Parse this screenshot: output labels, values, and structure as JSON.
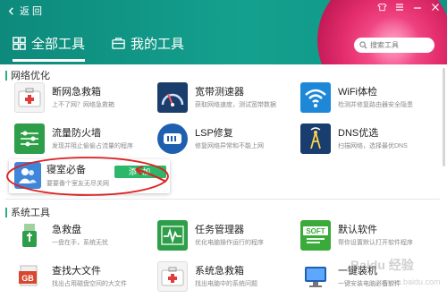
{
  "header": {
    "back_label": "返 回",
    "tabs": [
      {
        "label": "全部工具",
        "active": true
      },
      {
        "label": "我的工具",
        "active": false
      }
    ],
    "search_placeholder": "搜索工具",
    "window_controls": [
      "shirt-icon",
      "menu-icon",
      "minimize-icon",
      "close-icon"
    ]
  },
  "sections": [
    {
      "title": "网络优化",
      "items": [
        {
          "name": "断网急救箱",
          "desc": "上不了网？网络急救箱",
          "icon": "first-aid-kit-icon",
          "color": "#ffffff"
        },
        {
          "name": "宽带测速器",
          "desc": "获取网络速度，测试宽带数据",
          "icon": "speedometer-icon",
          "color": "#1b3d6b"
        },
        {
          "name": "WiFi体检",
          "desc": "检测并修复路由器安全隐患",
          "icon": "wifi-icon",
          "color": "#1e88d8"
        },
        {
          "name": "流量防火墙",
          "desc": "发现并阻止偷偷占流量的程序",
          "icon": "traffic-firewall-icon",
          "color": "#2e9e4a"
        },
        {
          "name": "LSP修复",
          "desc": "修复网络异常和不能上网",
          "icon": "lsp-repair-icon",
          "color": "#1f5fb0"
        },
        {
          "name": "DNS优选",
          "desc": "扫描网络，选择最优DNS",
          "icon": "dns-tower-icon",
          "color": "#1a3d70"
        },
        {
          "name": "寝室必备",
          "desc": "要要番个室友无尽关网",
          "icon": "roommates-icon",
          "color": "#3f86d8",
          "action": "添 加"
        }
      ]
    },
    {
      "title": "系统工具",
      "items": [
        {
          "name": "急救盘",
          "desc": "一盘在手，系统无忧",
          "icon": "usb-drive-icon",
          "color": "#2e9e4a"
        },
        {
          "name": "任务管理器",
          "desc": "优化电脑操作运行的程序",
          "icon": "task-manager-icon",
          "color": "#2e9e4a"
        },
        {
          "name": "默认软件",
          "desc": "帮你设置默认打开软件程序",
          "icon": "soft-icon",
          "color": "#3aaa3a"
        },
        {
          "name": "查找大文件",
          "desc": "找出占用磁盘空间的大文件",
          "icon": "gb-file-icon",
          "color": "#d9482e"
        },
        {
          "name": "系统急救箱",
          "desc": "找出电脑中的系统问题",
          "icon": "system-first-aid-icon",
          "color": "#ffffff"
        },
        {
          "name": "一键装机",
          "desc": "一键安装电脑必备软件",
          "icon": "monitor-icon",
          "color": "#1f5fb0"
        }
      ]
    }
  ],
  "watermark": "Baidu 经验",
  "watermark_sub": "jingyan.baidu.com"
}
